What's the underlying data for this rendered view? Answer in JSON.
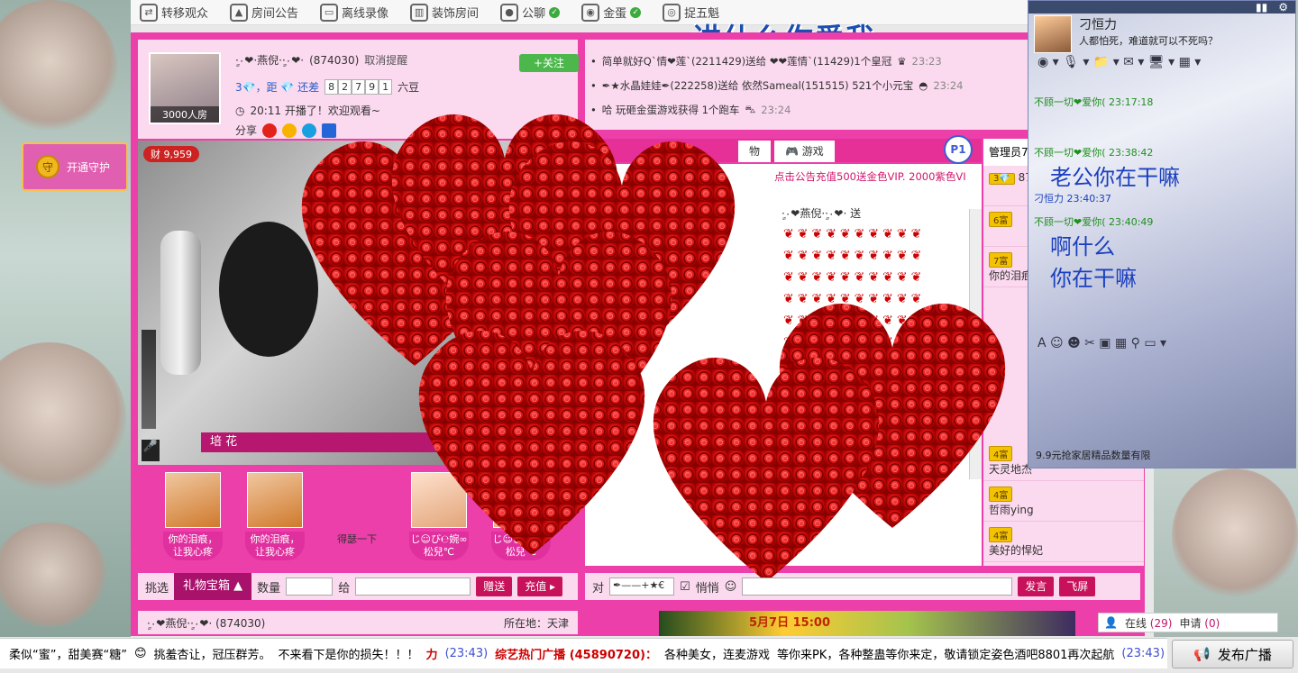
{
  "topbar": {
    "items": [
      {
        "label": "转移观众",
        "icon": "transfer-icon"
      },
      {
        "label": "房间公告",
        "icon": "announcement-icon"
      },
      {
        "label": "离线录像",
        "icon": "recording-icon"
      },
      {
        "label": "装饰房间",
        "icon": "decorate-icon"
      },
      {
        "label": "公聊",
        "icon": "public-chat-icon"
      },
      {
        "label": "金蛋",
        "icon": "location-icon"
      },
      {
        "label": "捉五魁",
        "icon": "game-icon"
      }
    ],
    "banner": "讲什么你爱我"
  },
  "guard": {
    "label": "开通守护"
  },
  "host": {
    "name": "ٍ·٠❤·燕倪·ٍ·٠❤·",
    "id": "(874030)",
    "cancel_remind": "取消提醒",
    "follow": "+关注",
    "room_count": "3000人房",
    "level_text": "3💎，距 💎 还差",
    "digits": [
      "8",
      "2",
      "7",
      "9",
      "1"
    ],
    "beans": "六豆",
    "start_text": "20:11 开播了！欢迎观看~",
    "share": "分享"
  },
  "video": {
    "gold": "9,959",
    "flower_label": "培 花"
  },
  "gifts": [
    {
      "caption1": "你的泪痕，",
      "caption2": "让我心疼"
    },
    {
      "caption1": "你的泪痕，",
      "caption2": "让我心疼"
    },
    {
      "caption1": "得瑟一下",
      "caption2": ""
    },
    {
      "caption1": "じ☺び℮婉∞",
      "caption2": "松兒℃"
    },
    {
      "caption1": "じ☺び℮婉∞",
      "caption2": "松兒℃"
    }
  ],
  "gift_bar": {
    "select": "挑选",
    "box": "礼物宝箱",
    "qty": "数量",
    "to": "给",
    "give": "赠送",
    "recharge": "充值"
  },
  "host_footer": {
    "name": "ٍ·٠❤燕倪·ٍ·٠❤·",
    "id": "(874030)",
    "location": "所在地：天津"
  },
  "news": [
    {
      "text": "简单就好Q`情❤莲`(2211429)送给 ❤❤莲情`(11429)1个皇冠",
      "time": "23:23"
    },
    {
      "text": "✒★水晶娃娃✒(222258)送给 依然Sameal(151515) 521个小元宝",
      "time": "23:24"
    },
    {
      "text": "哈 玩砸金蛋游戏获得 1个跑车",
      "time": "23:24"
    }
  ],
  "tabs": {
    "gift": "物",
    "games": "游戏",
    "p1": "P1"
  },
  "chat": {
    "notice": "点击公告充值500送金色VIP. 2000紫色VI",
    "sender": "ٍ·٠❤燕倪·ٍ·٠❤·",
    "send": "送"
  },
  "admin": {
    "title": "管理员7",
    "items": [
      {
        "level": "3💎",
        "name": "874"
      },
      {
        "level": "6富",
        "name": ""
      },
      {
        "level": "7富",
        "name": "你的泪痕"
      },
      {
        "level": "4富",
        "name": "天灵地杰"
      },
      {
        "level": "4富",
        "name": "哲雨ying"
      },
      {
        "level": "4富",
        "name": "美好的悍妃"
      }
    ]
  },
  "input_bar": {
    "to": "对",
    "target": "✒——+★€",
    "whisper": "悄悄",
    "send": "发言",
    "fly": "飞屏"
  },
  "ad": {
    "text": "5月7日 15:00"
  },
  "online": {
    "online_label": "在线",
    "online_count": "(29)",
    "apply_label": "申请",
    "apply_count": "(0)"
  },
  "marquee": {
    "part1": "柔似“蜜”，甜美赛“糖”",
    "part2": "挑羞杏让，冠压群芳。",
    "part3": "不来看下是你的损失！！！",
    "time1": "(23:43)",
    "part4": "综艺热门广播 (45890720)：",
    "part5": "各种美女，连麦游戏",
    "part6": "等你来PK，各种整蛊等你来定，敬请锁定姿色酒吧8801再次起航",
    "time2": "(23:43)",
    "broadcast": "发布广播"
  },
  "qq": {
    "contact": "刁恒力",
    "signature": "人都怕死，难道就可以不死吗？",
    "msgs": [
      {
        "meta": "不顾一切❤爱你(  23:17:18",
        "big": ""
      },
      {
        "meta": "不顾一切❤爱你(  23:38:42",
        "big": "老公你在干嘛"
      },
      {
        "meta": "刁恒力  23:40:37",
        "big": ""
      },
      {
        "meta": "不顾一切❤爱你(  23:40:49",
        "big": "啊什么"
      },
      {
        "meta": "",
        "big": "你在干嘛"
      }
    ],
    "footer": "9.9元抢家居精品数量有限"
  }
}
